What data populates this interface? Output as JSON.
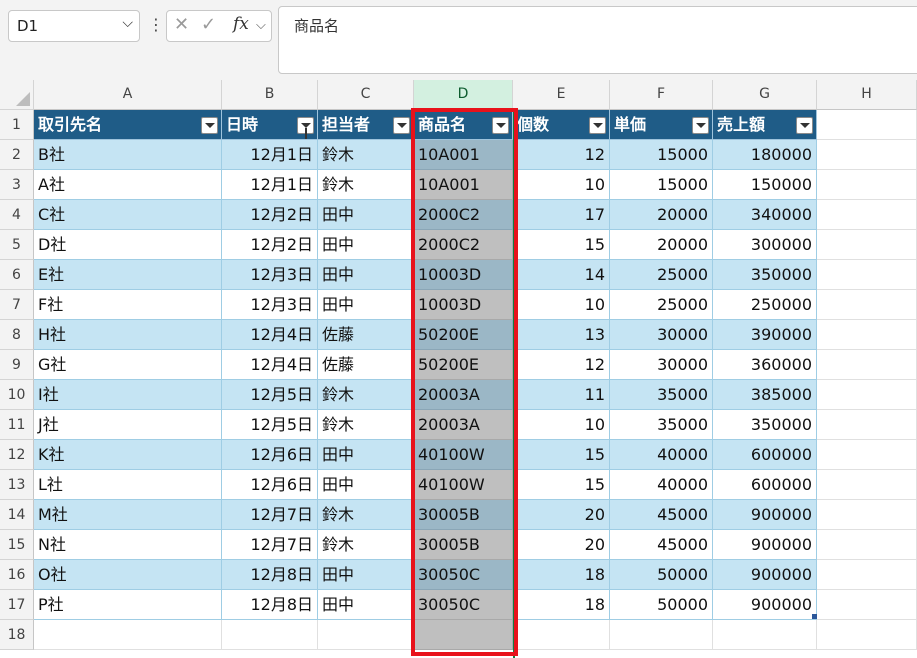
{
  "name_box": {
    "value": "D1"
  },
  "formula_bar": {
    "value": "商品名",
    "fx_label": "fx"
  },
  "columns": [
    "A",
    "B",
    "C",
    "D",
    "E",
    "F",
    "G",
    "H"
  ],
  "rows": [
    "1",
    "2",
    "3",
    "4",
    "5",
    "6",
    "7",
    "8",
    "9",
    "10",
    "11",
    "12",
    "13",
    "14",
    "15",
    "16",
    "17",
    "18"
  ],
  "selected_column": "D",
  "table": {
    "headers": [
      "取引先名",
      "日時",
      "担当者",
      "商品名",
      "個数",
      "単価",
      "売上額"
    ],
    "rows": [
      [
        "B社",
        "12月1日",
        "鈴木",
        "10A001",
        "12",
        "15000",
        "180000"
      ],
      [
        "A社",
        "12月1日",
        "鈴木",
        "10A001",
        "10",
        "15000",
        "150000"
      ],
      [
        "C社",
        "12月2日",
        "田中",
        "2000C2",
        "17",
        "20000",
        "340000"
      ],
      [
        "D社",
        "12月2日",
        "田中",
        "2000C2",
        "15",
        "20000",
        "300000"
      ],
      [
        "E社",
        "12月3日",
        "田中",
        "10003D",
        "14",
        "25000",
        "350000"
      ],
      [
        "F社",
        "12月3日",
        "田中",
        "10003D",
        "10",
        "25000",
        "250000"
      ],
      [
        "H社",
        "12月4日",
        "佐藤",
        "50200E",
        "13",
        "30000",
        "390000"
      ],
      [
        "G社",
        "12月4日",
        "佐藤",
        "50200E",
        "12",
        "30000",
        "360000"
      ],
      [
        "I社",
        "12月5日",
        "鈴木",
        "20003A",
        "11",
        "35000",
        "385000"
      ],
      [
        "J社",
        "12月5日",
        "鈴木",
        "20003A",
        "10",
        "35000",
        "350000"
      ],
      [
        "K社",
        "12月6日",
        "田中",
        "40100W",
        "15",
        "40000",
        "600000"
      ],
      [
        "L社",
        "12月6日",
        "田中",
        "40100W",
        "15",
        "40000",
        "600000"
      ],
      [
        "M社",
        "12月7日",
        "鈴木",
        "30005B",
        "20",
        "45000",
        "900000"
      ],
      [
        "N社",
        "12月7日",
        "鈴木",
        "30005B",
        "20",
        "45000",
        "900000"
      ],
      [
        "O社",
        "12月8日",
        "田中",
        "30050C",
        "18",
        "50000",
        "900000"
      ],
      [
        "P社",
        "12月8日",
        "田中",
        "30050C",
        "18",
        "50000",
        "900000"
      ]
    ]
  },
  "colors": {
    "header": "#1f5c87",
    "band": "#c5e4f3",
    "selection_border": "#e8121b",
    "selected_header": "#d3f0e0"
  }
}
